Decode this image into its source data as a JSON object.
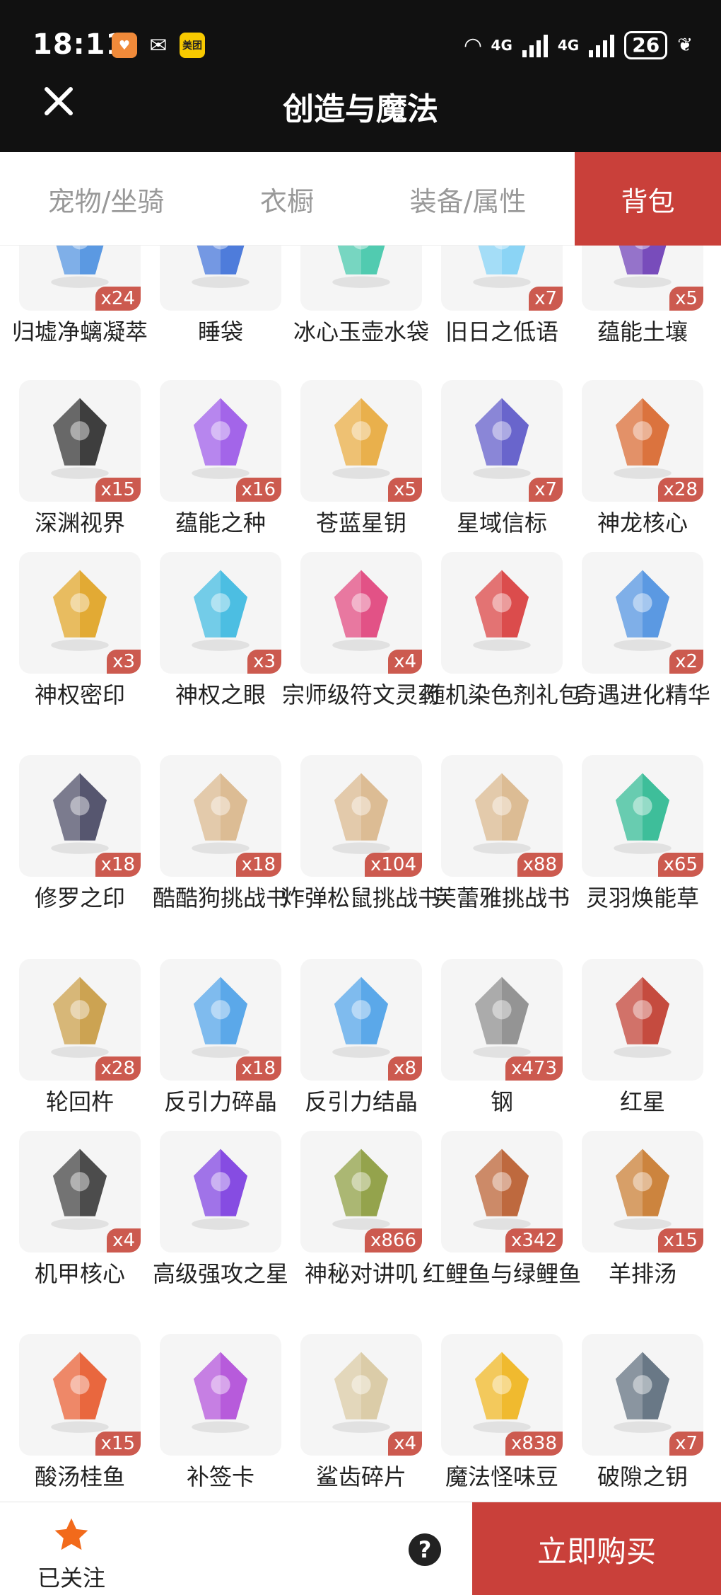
{
  "status_bar": {
    "time": "18:11",
    "app_icons": [
      {
        "name": "heart-app-icon",
        "label": "",
        "color": "#f08a3a"
      },
      {
        "name": "wechat-icon",
        "label": "",
        "color": "#ffffff"
      },
      {
        "name": "meituan-icon",
        "label": "美团",
        "color": "#f7c900"
      }
    ],
    "network_1": "4G",
    "network_2": "4G",
    "battery": "26"
  },
  "header": {
    "title": "创造与魔法"
  },
  "tabs": [
    {
      "label": "宠物/坐骑",
      "active": false
    },
    {
      "label": "衣橱",
      "active": false
    },
    {
      "label": "装备/属性",
      "active": false
    },
    {
      "label": "背包",
      "active": true
    }
  ],
  "items": [
    {
      "name": "归墟净螭凝萃",
      "qty": "x24",
      "color": "#4a8fe0",
      "icon": "crystal-icon"
    },
    {
      "name": "睡袋",
      "qty": "",
      "color": "#3c6fd8",
      "icon": "sleeping-bag-icon"
    },
    {
      "name": "冰心玉壶水袋",
      "qty": "",
      "color": "#3fc7a8",
      "icon": "water-pouch-icon"
    },
    {
      "name": "旧日之低语",
      "qty": "x7",
      "color": "#7fd0f5",
      "icon": "orb-icon"
    },
    {
      "name": "蕴能土壤",
      "qty": "x5",
      "color": "#6a3ab5",
      "icon": "soil-icon"
    },
    {
      "name": "深渊视界",
      "qty": "x15",
      "color": "#2a2a2a",
      "icon": "abyss-eye-icon"
    },
    {
      "name": "蕴能之种",
      "qty": "x16",
      "color": "#9a55e8",
      "icon": "gem-seed-icon"
    },
    {
      "name": "苍蓝星钥",
      "qty": "x5",
      "color": "#e8a93a",
      "icon": "star-key-icon"
    },
    {
      "name": "星域信标",
      "qty": "x7",
      "color": "#5a55c8",
      "icon": "beacon-icon"
    },
    {
      "name": "神龙核心",
      "qty": "x28",
      "color": "#d8652a",
      "icon": "dragon-core-icon"
    },
    {
      "name": "神权密印",
      "qty": "x3",
      "color": "#e0a21f",
      "icon": "seal-coin-icon"
    },
    {
      "name": "神权之眼",
      "qty": "x3",
      "color": "#3ab8e0",
      "icon": "eye-emblem-icon"
    },
    {
      "name": "宗师级符文灵药",
      "qty": "x4",
      "color": "#e0407a",
      "icon": "potion-icon"
    },
    {
      "name": "随机染色剂礼包",
      "qty": "",
      "color": "#d83a3a",
      "icon": "gift-box-icon"
    },
    {
      "name": "奇遇进化精华",
      "qty": "x2",
      "color": "#4a8fe0",
      "icon": "evolution-fruit-icon"
    },
    {
      "name": "修罗之印",
      "qty": "x18",
      "color": "#454560",
      "icon": "card-icon"
    },
    {
      "name": "酷酷狗挑战书",
      "qty": "x18",
      "color": "#d9b68a",
      "icon": "wanted-scroll-icon"
    },
    {
      "name": "炸弹松鼠挑战书",
      "qty": "x104",
      "color": "#d9b68a",
      "icon": "wanted-scroll-icon"
    },
    {
      "name": "芙蕾雅挑战书",
      "qty": "x88",
      "color": "#d9b68a",
      "icon": "wanted-scroll-icon"
    },
    {
      "name": "灵羽焕能草",
      "qty": "x65",
      "color": "#2ab890",
      "icon": "herb-icon"
    },
    {
      "name": "轮回杵",
      "qty": "x28",
      "color": "#c89a40",
      "icon": "pestle-icon"
    },
    {
      "name": "反引力碎晶",
      "qty": "x18",
      "color": "#4aa0e8",
      "icon": "crystal-cluster-icon"
    },
    {
      "name": "反引力结晶",
      "qty": "x8",
      "color": "#4aa0e8",
      "icon": "crystal-cluster-icon"
    },
    {
      "name": "钢",
      "qty": "x473",
      "color": "#8a8a8a",
      "icon": "steel-ingot-icon"
    },
    {
      "name": "红星",
      "qty": "",
      "color": "#c0392b",
      "icon": "motorbike-icon"
    },
    {
      "name": "机甲核心",
      "qty": "x4",
      "color": "#3a3a3a",
      "icon": "mech-core-icon"
    },
    {
      "name": "高级强攻之星",
      "qty": "",
      "color": "#7a3ae0",
      "icon": "purple-gem-icon"
    },
    {
      "name": "神秘对讲叽",
      "qty": "x866",
      "color": "#8a9a3a",
      "icon": "bird-radio-icon"
    },
    {
      "name": "红鲤鱼与绿鲤鱼",
      "qty": "x342",
      "color": "#b85a2a",
      "icon": "fish-dish-icon"
    },
    {
      "name": "羊排汤",
      "qty": "x15",
      "color": "#c8782a",
      "icon": "soup-bowl-icon"
    },
    {
      "name": "酸汤桂鱼",
      "qty": "x15",
      "color": "#e8582a",
      "icon": "fish-soup-icon"
    },
    {
      "name": "补签卡",
      "qty": "",
      "color": "#b04ad8",
      "icon": "ticket-icon"
    },
    {
      "name": "鲨齿碎片",
      "qty": "x4",
      "color": "#d8c8a0",
      "icon": "tooth-icon"
    },
    {
      "name": "魔法怪味豆",
      "qty": "x838",
      "color": "#f0b41a",
      "icon": "bean-icon"
    },
    {
      "name": "破隙之钥",
      "qty": "x7",
      "color": "#5a6a7a",
      "icon": "dark-key-icon"
    }
  ],
  "bottom_bar": {
    "follow_label": "已关注",
    "help_symbol": "?",
    "buy_label": "立即购买"
  }
}
